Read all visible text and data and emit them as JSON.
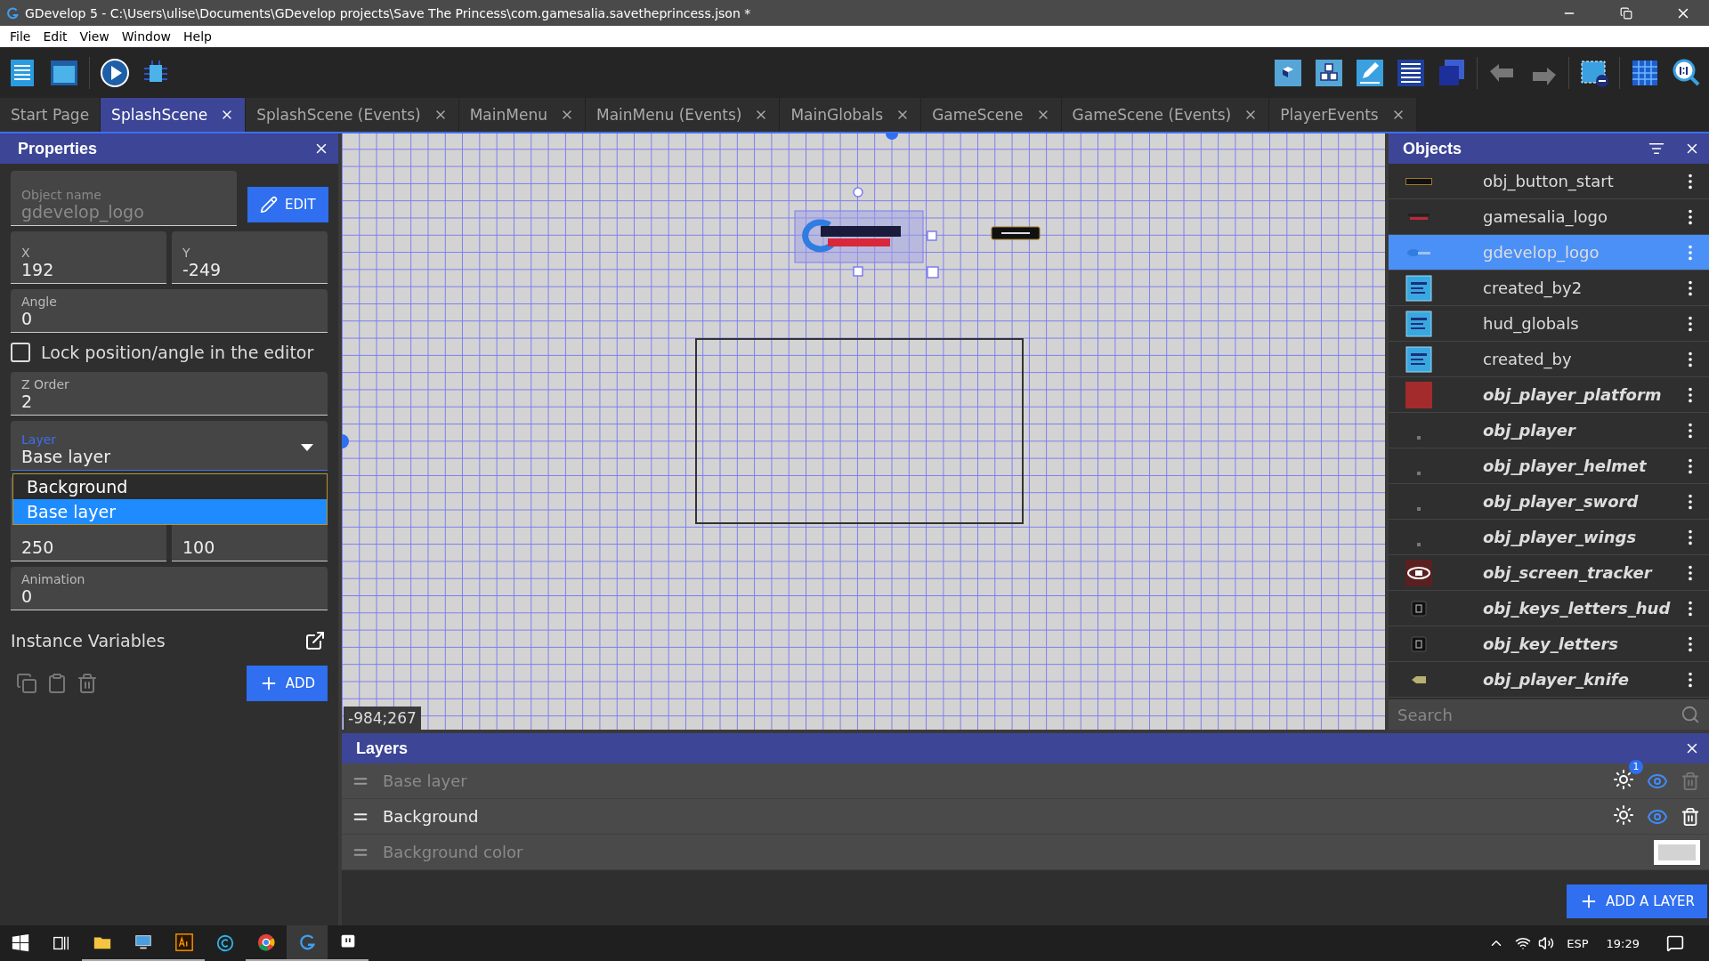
{
  "window": {
    "title": "GDevelop 5 - C:\\Users\\ulise\\Documents\\GDevelop projects\\Save The Princess\\com.gamesalia.savetheprincess.json *"
  },
  "menu": [
    "File",
    "Edit",
    "View",
    "Window",
    "Help"
  ],
  "tabs": [
    {
      "label": "Start Page",
      "selected": false,
      "closable": false
    },
    {
      "label": "SplashScene",
      "selected": true,
      "closable": true
    },
    {
      "label": "SplashScene (Events)",
      "selected": false,
      "closable": true
    },
    {
      "label": "MainMenu",
      "selected": false,
      "closable": true
    },
    {
      "label": "MainMenu (Events)",
      "selected": false,
      "closable": true
    },
    {
      "label": "MainGlobals",
      "selected": false,
      "closable": true
    },
    {
      "label": "GameScene",
      "selected": false,
      "closable": true
    },
    {
      "label": "GameScene (Events)",
      "selected": false,
      "closable": true
    },
    {
      "label": "PlayerEvents",
      "selected": false,
      "closable": true
    }
  ],
  "properties": {
    "title": "Properties",
    "object_name": {
      "label": "Object name",
      "value": "gdevelop_logo",
      "disabled": true
    },
    "edit_button": "EDIT",
    "x": {
      "label": "X",
      "value": "192"
    },
    "y": {
      "label": "Y",
      "value": "-249"
    },
    "angle": {
      "label": "Angle",
      "value": "0"
    },
    "lock": {
      "label": "Lock position/angle in the editor",
      "checked": false
    },
    "z_order": {
      "label": "Z Order",
      "value": "2"
    },
    "layer": {
      "label": "Layer",
      "value": "Base layer",
      "expanded": true,
      "options": [
        {
          "label": "Background",
          "selected": false
        },
        {
          "label": "Base layer",
          "selected": true
        }
      ]
    },
    "width": {
      "value": "250"
    },
    "height": {
      "value": "100"
    },
    "animation": {
      "label": "Animation",
      "value": "0"
    },
    "instance_variables": "Instance Variables",
    "add_button": "ADD"
  },
  "canvas": {
    "cursor_position": "-984;267"
  },
  "objects": {
    "title": "Objects",
    "items": [
      {
        "name": "obj_button_start",
        "kind": "button",
        "global": false,
        "selected": false
      },
      {
        "name": "gamesalia_logo",
        "kind": "logo",
        "global": false,
        "selected": false
      },
      {
        "name": "gdevelop_logo",
        "kind": "swirl",
        "global": false,
        "selected": true
      },
      {
        "name": "created_by2",
        "kind": "text",
        "global": false,
        "selected": false
      },
      {
        "name": "hud_globals",
        "kind": "text",
        "global": false,
        "selected": false
      },
      {
        "name": "created_by",
        "kind": "text",
        "global": false,
        "selected": false
      },
      {
        "name": "obj_player_platform",
        "kind": "block",
        "global": true,
        "selected": false
      },
      {
        "name": "obj_player",
        "kind": "speck",
        "global": true,
        "selected": false
      },
      {
        "name": "obj_player_helmet",
        "kind": "speck",
        "global": true,
        "selected": false
      },
      {
        "name": "obj_player_sword",
        "kind": "speck",
        "global": true,
        "selected": false
      },
      {
        "name": "obj_player_wings",
        "kind": "speck",
        "global": true,
        "selected": false
      },
      {
        "name": "obj_screen_tracker",
        "kind": "tracker",
        "global": true,
        "selected": false
      },
      {
        "name": "obj_keys_letters_hud",
        "kind": "key",
        "global": true,
        "selected": false
      },
      {
        "name": "obj_key_letters",
        "kind": "key",
        "global": true,
        "selected": false
      },
      {
        "name": "obj_player_knife",
        "kind": "knife",
        "global": true,
        "selected": false
      }
    ],
    "search": {
      "placeholder": "Search"
    }
  },
  "layers": {
    "title": "Layers",
    "items": [
      {
        "name": "Base layer",
        "kind": "layer",
        "dimmed": true,
        "badge": "1",
        "delete_disabled": true
      },
      {
        "name": "Background",
        "kind": "layer",
        "dimmed": false,
        "delete_disabled": false
      },
      {
        "name": "Background color",
        "kind": "color",
        "dimmed": true
      }
    ],
    "add_button": "ADD A LAYER"
  },
  "taskbar": {
    "language": "ESP",
    "time": "19:29"
  }
}
